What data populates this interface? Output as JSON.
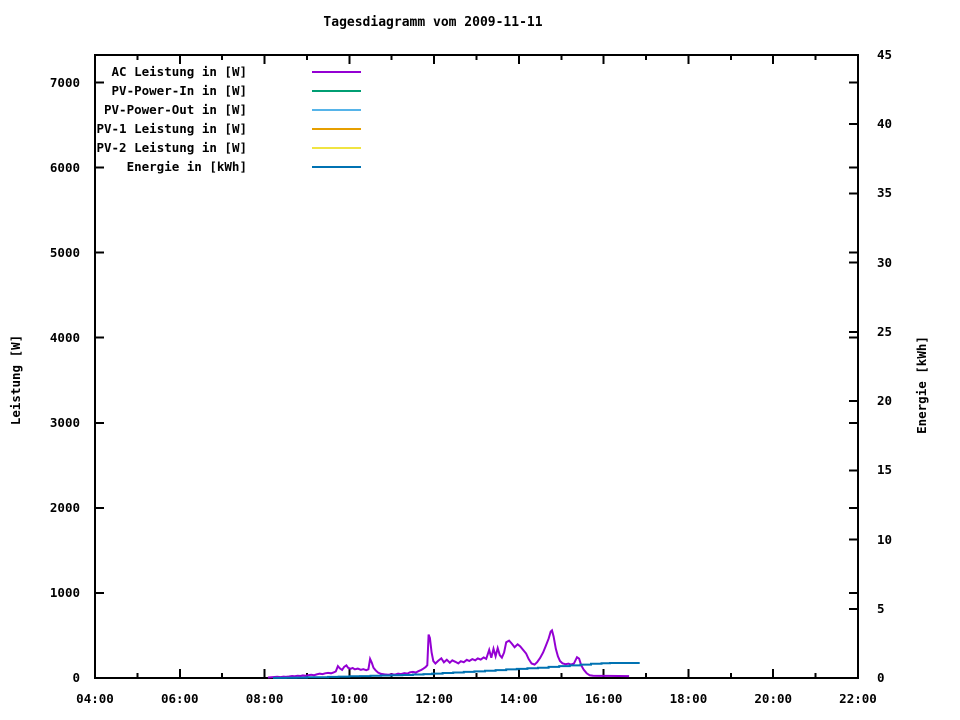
{
  "title": "Tagesdiagramm vom 2009-11-11",
  "chart_data": {
    "type": "line",
    "title": "Tagesdiagramm vom 2009-11-11",
    "background": "#ffffff",
    "border_color": "#000000",
    "grid": false,
    "legend_position": "top-left-inside",
    "x_axis": {
      "unit": "time-of-day",
      "range_hours": [
        4,
        22
      ],
      "tick_hours": [
        4,
        6,
        8,
        10,
        12,
        14,
        16,
        18,
        20,
        22
      ],
      "tick_labels": [
        "04:00",
        "06:00",
        "08:00",
        "10:00",
        "12:00",
        "14:00",
        "16:00",
        "18:00",
        "20:00",
        "22:00"
      ],
      "minor_tick_step_hours": 1
    },
    "y_axis_left": {
      "label": "Leistung [W]",
      "range": [
        0,
        7324
      ],
      "tick_values": [
        0,
        1000,
        2000,
        3000,
        4000,
        5000,
        6000,
        7000
      ],
      "tick_labels": [
        "0",
        "1000",
        "2000",
        "3000",
        "4000",
        "5000",
        "6000",
        "7000"
      ]
    },
    "y_axis_right": {
      "label": "Energie [kWh]",
      "range": [
        0,
        45
      ],
      "tick_values": [
        0,
        5,
        10,
        15,
        20,
        25,
        30,
        35,
        40,
        45
      ],
      "tick_labels": [
        "0",
        "5",
        "10",
        "15",
        "20",
        "25",
        "30",
        "35",
        "40",
        "45"
      ]
    },
    "series": [
      {
        "id": "ac-leistung",
        "name": "AC Leistung in [W]",
        "color": "#9400d3",
        "axis": "left",
        "style": "line",
        "points": [
          [
            8.08,
            6
          ],
          [
            8.2,
            10
          ],
          [
            8.3,
            14
          ],
          [
            8.38,
            11
          ],
          [
            8.45,
            16
          ],
          [
            8.5,
            13
          ],
          [
            8.58,
            18
          ],
          [
            8.65,
            24
          ],
          [
            8.7,
            20
          ],
          [
            8.78,
            27
          ],
          [
            8.85,
            23
          ],
          [
            8.9,
            30
          ],
          [
            8.97,
            26
          ],
          [
            9.03,
            33
          ],
          [
            9.1,
            38
          ],
          [
            9.17,
            33
          ],
          [
            9.23,
            42
          ],
          [
            9.3,
            50
          ],
          [
            9.37,
            46
          ],
          [
            9.43,
            55
          ],
          [
            9.5,
            60
          ],
          [
            9.57,
            55
          ],
          [
            9.63,
            65
          ],
          [
            9.68,
            78
          ],
          [
            9.73,
            140
          ],
          [
            9.78,
            112
          ],
          [
            9.83,
            95
          ],
          [
            9.88,
            132
          ],
          [
            9.93,
            148
          ],
          [
            9.97,
            120
          ],
          [
            10.03,
            108
          ],
          [
            10.08,
            118
          ],
          [
            10.13,
            102
          ],
          [
            10.2,
            110
          ],
          [
            10.27,
            96
          ],
          [
            10.33,
            104
          ],
          [
            10.4,
            92
          ],
          [
            10.45,
            102
          ],
          [
            10.49,
            225
          ],
          [
            10.53,
            180
          ],
          [
            10.57,
            120
          ],
          [
            10.62,
            90
          ],
          [
            10.68,
            62
          ],
          [
            10.75,
            48
          ],
          [
            10.83,
            42
          ],
          [
            10.92,
            38
          ],
          [
            11.0,
            44
          ],
          [
            11.08,
            40
          ],
          [
            11.15,
            50
          ],
          [
            11.22,
            46
          ],
          [
            11.3,
            58
          ],
          [
            11.37,
            52
          ],
          [
            11.43,
            66
          ],
          [
            11.5,
            72
          ],
          [
            11.57,
            65
          ],
          [
            11.63,
            80
          ],
          [
            11.7,
            95
          ],
          [
            11.75,
            110
          ],
          [
            11.8,
            128
          ],
          [
            11.84,
            150
          ],
          [
            11.87,
            510
          ],
          [
            11.9,
            470
          ],
          [
            11.94,
            300
          ],
          [
            11.98,
            200
          ],
          [
            12.03,
            170
          ],
          [
            12.1,
            205
          ],
          [
            12.17,
            232
          ],
          [
            12.23,
            185
          ],
          [
            12.3,
            215
          ],
          [
            12.37,
            180
          ],
          [
            12.43,
            208
          ],
          [
            12.5,
            190
          ],
          [
            12.57,
            172
          ],
          [
            12.63,
            198
          ],
          [
            12.7,
            186
          ],
          [
            12.77,
            214
          ],
          [
            12.83,
            200
          ],
          [
            12.9,
            222
          ],
          [
            12.97,
            208
          ],
          [
            13.03,
            230
          ],
          [
            13.1,
            216
          ],
          [
            13.17,
            242
          ],
          [
            13.23,
            224
          ],
          [
            13.3,
            330
          ],
          [
            13.35,
            238
          ],
          [
            13.4,
            345
          ],
          [
            13.45,
            255
          ],
          [
            13.5,
            352
          ],
          [
            13.55,
            268
          ],
          [
            13.6,
            240
          ],
          [
            13.65,
            300
          ],
          [
            13.7,
            420
          ],
          [
            13.77,
            440
          ],
          [
            13.83,
            405
          ],
          [
            13.9,
            362
          ],
          [
            13.97,
            396
          ],
          [
            14.03,
            372
          ],
          [
            14.1,
            330
          ],
          [
            14.17,
            288
          ],
          [
            14.23,
            225
          ],
          [
            14.3,
            170
          ],
          [
            14.37,
            158
          ],
          [
            14.43,
            186
          ],
          [
            14.5,
            235
          ],
          [
            14.57,
            300
          ],
          [
            14.63,
            372
          ],
          [
            14.7,
            462
          ],
          [
            14.75,
            545
          ],
          [
            14.78,
            560
          ],
          [
            14.82,
            488
          ],
          [
            14.87,
            345
          ],
          [
            14.92,
            255
          ],
          [
            14.97,
            200
          ],
          [
            15.03,
            172
          ],
          [
            15.1,
            162
          ],
          [
            15.17,
            168
          ],
          [
            15.23,
            158
          ],
          [
            15.3,
            172
          ],
          [
            15.37,
            245
          ],
          [
            15.42,
            228
          ],
          [
            15.47,
            150
          ],
          [
            15.53,
            98
          ],
          [
            15.6,
            55
          ],
          [
            15.67,
            32
          ],
          [
            15.75,
            26
          ],
          [
            15.9,
            25
          ],
          [
            16.1,
            25
          ],
          [
            16.35,
            24
          ],
          [
            16.6,
            22
          ]
        ]
      },
      {
        "id": "pv-power-in",
        "name": "PV-Power-In in [W]",
        "color": "#009e73",
        "axis": "left",
        "style": "line",
        "points": []
      },
      {
        "id": "pv-power-out",
        "name": "PV-Power-Out in [W]",
        "color": "#56b4e9",
        "axis": "left",
        "style": "line",
        "points": []
      },
      {
        "id": "pv-1-leistung",
        "name": "PV-1 Leistung in [W]",
        "color": "#e69f00",
        "axis": "left",
        "style": "line",
        "points": []
      },
      {
        "id": "pv-2-leistung",
        "name": "PV-2 Leistung in [W]",
        "color": "#f0e442",
        "axis": "left",
        "style": "line",
        "points": []
      },
      {
        "id": "energie",
        "name": "Energie in [kWh]",
        "color": "#0072b2",
        "axis": "right",
        "style": "steps",
        "points": [
          [
            8.2,
            0.01
          ],
          [
            8.5,
            0.02
          ],
          [
            8.75,
            0.03
          ],
          [
            9.0,
            0.05
          ],
          [
            9.25,
            0.06
          ],
          [
            9.5,
            0.08
          ],
          [
            9.75,
            0.1
          ],
          [
            10.0,
            0.12
          ],
          [
            10.25,
            0.14
          ],
          [
            10.5,
            0.16
          ],
          [
            10.75,
            0.18
          ],
          [
            11.0,
            0.2
          ],
          [
            11.25,
            0.22
          ],
          [
            11.5,
            0.25
          ],
          [
            11.75,
            0.28
          ],
          [
            11.95,
            0.32
          ],
          [
            12.2,
            0.36
          ],
          [
            12.45,
            0.4
          ],
          [
            12.7,
            0.44
          ],
          [
            12.95,
            0.48
          ],
          [
            13.2,
            0.52
          ],
          [
            13.45,
            0.57
          ],
          [
            13.7,
            0.62
          ],
          [
            13.95,
            0.66
          ],
          [
            14.2,
            0.7
          ],
          [
            14.45,
            0.74
          ],
          [
            14.7,
            0.8
          ],
          [
            14.95,
            0.86
          ],
          [
            15.2,
            0.91
          ],
          [
            15.45,
            0.97
          ],
          [
            15.7,
            1.03
          ],
          [
            15.95,
            1.07
          ],
          [
            16.15,
            1.08
          ],
          [
            16.85,
            1.08
          ]
        ]
      }
    ]
  }
}
